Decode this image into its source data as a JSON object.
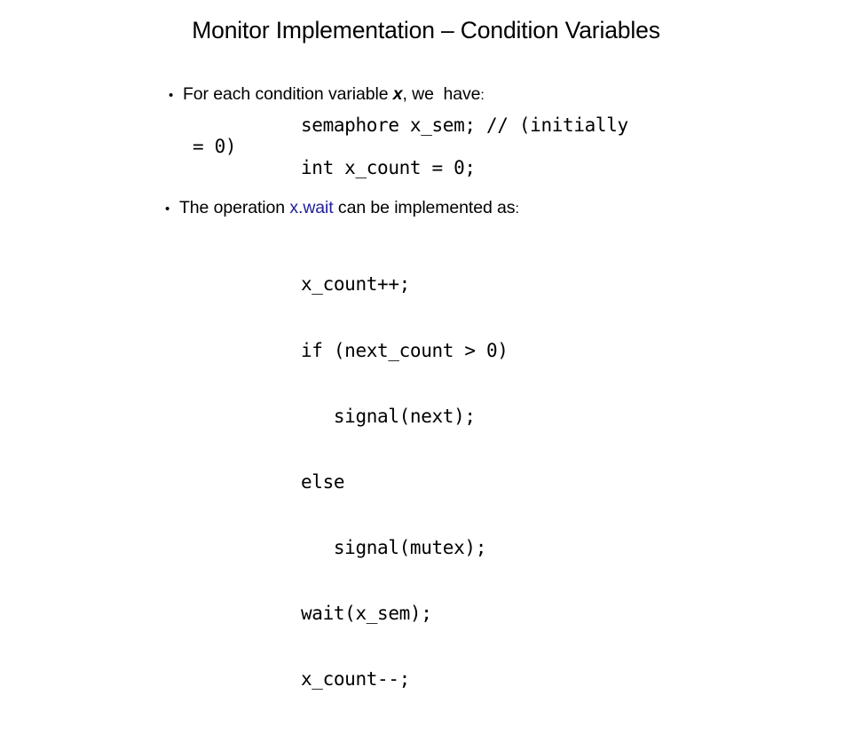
{
  "slide": {
    "title": "Monitor Implementation – Condition Variables",
    "background_color": "#ffffff",
    "text_color": "#000000",
    "accent_color": "#20209c"
  },
  "bullets": [
    {
      "marker": "•",
      "text_before_var": "For each condition variable ",
      "variable": "x",
      "text_after_var": ", we  have",
      "colon": ":"
    },
    {
      "marker": "•",
      "text_before_code": "The operation ",
      "code_term": "x.wait",
      "text_after_code": " can be implemented as",
      "colon": ":"
    }
  ],
  "declaration_code": {
    "line_1": "semaphore x_sem; // (initially",
    "line_1_wrap": "= 0)",
    "line_2": "int x_count = 0;"
  },
  "wait_code": {
    "lines": [
      "x_count++;",
      "if (next_count > 0)",
      "   signal(next);",
      "else",
      "   signal(mutex);",
      "wait(x_sem);",
      "x_count--;"
    ]
  }
}
